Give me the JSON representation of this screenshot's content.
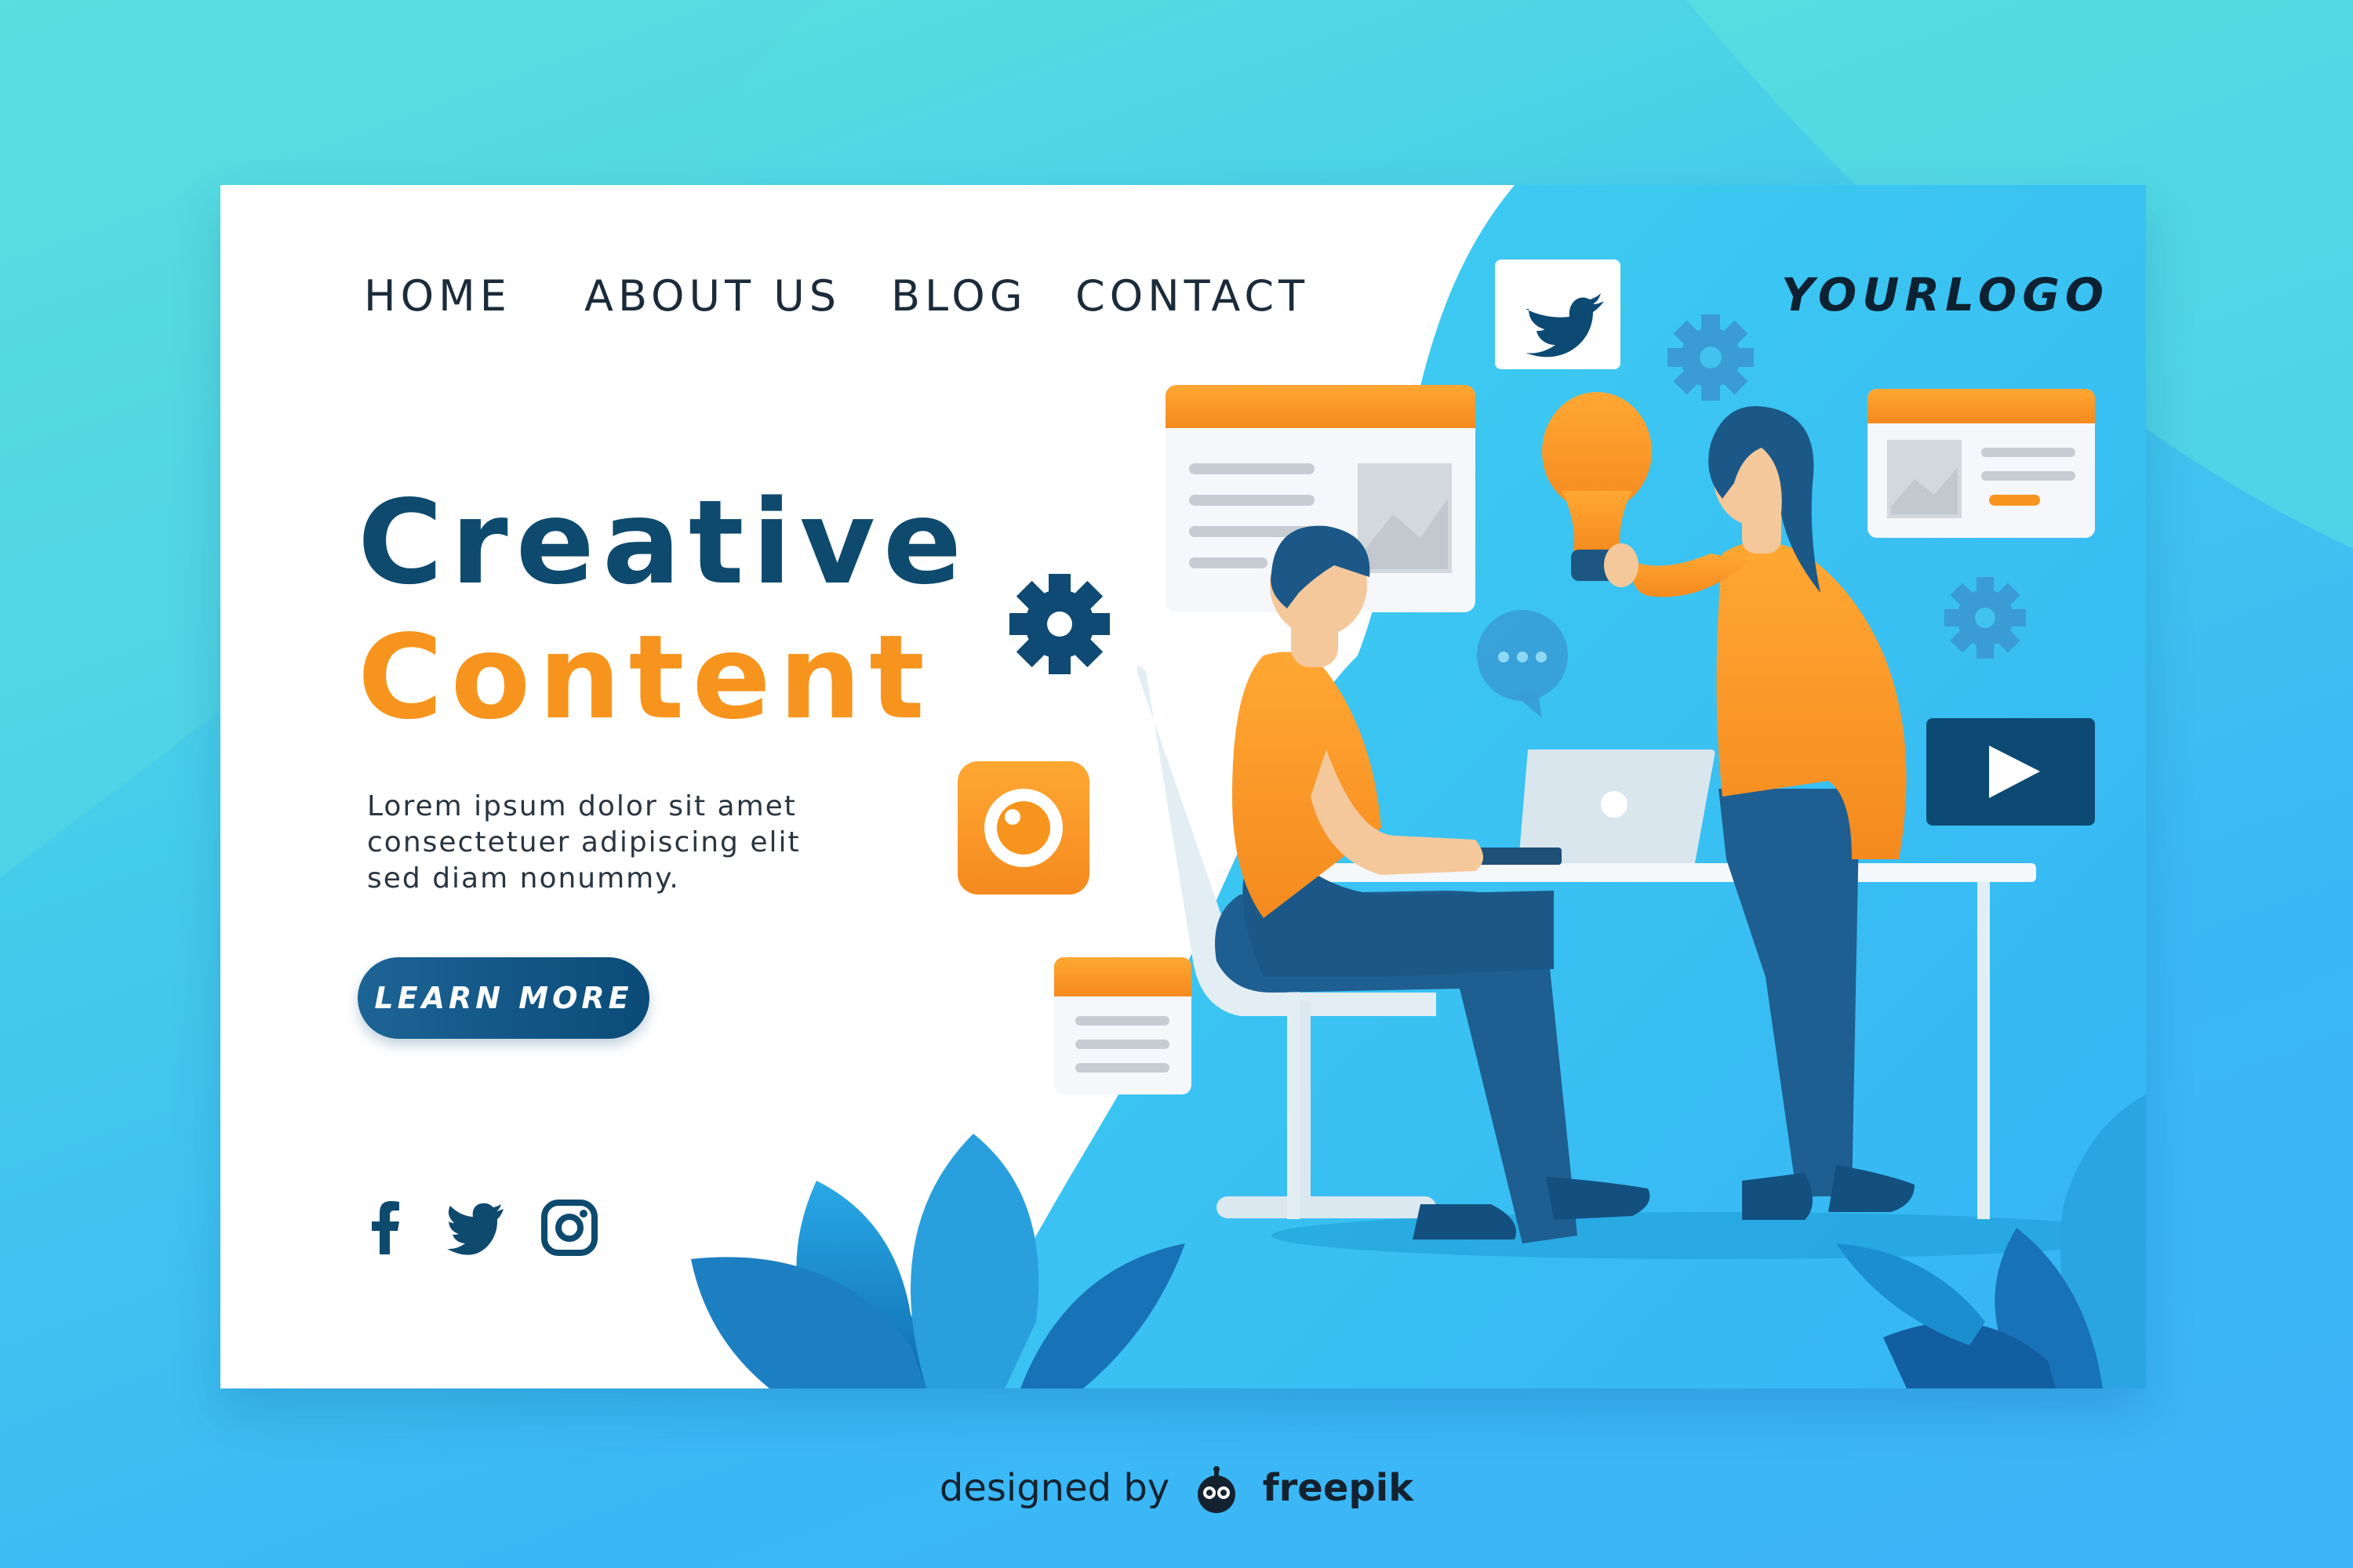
{
  "nav": {
    "items": [
      {
        "label": "HOME"
      },
      {
        "label": "ABOUT US"
      },
      {
        "label": "BLOG"
      },
      {
        "label": "CONTACT"
      }
    ],
    "logo": "YOURLOGO"
  },
  "hero": {
    "title_line1": "Creative",
    "title_line2": "Content",
    "body_lines": [
      "Lorem ipsum dolor sit amet",
      "consectetuer adipiscing elit",
      "sed diam nonummy."
    ],
    "button_label": "LEARN MORE"
  },
  "social": {
    "icons": [
      "facebook-icon",
      "twitter-icon",
      "instagram-icon"
    ]
  },
  "illustration": {
    "icons": [
      "twitter-icon",
      "gear-icon",
      "lightbulb-icon",
      "chat-bubble-icon",
      "camera-icon",
      "play-icon",
      "image-card-icon",
      "text-card-icon"
    ]
  },
  "footer": {
    "prefix": "designed by",
    "brand": "freepik"
  },
  "colors": {
    "navy": "#0e4a6e",
    "orange": "#f7941d",
    "sky": "#3ab9f5",
    "teal": "#5ee6dc"
  }
}
